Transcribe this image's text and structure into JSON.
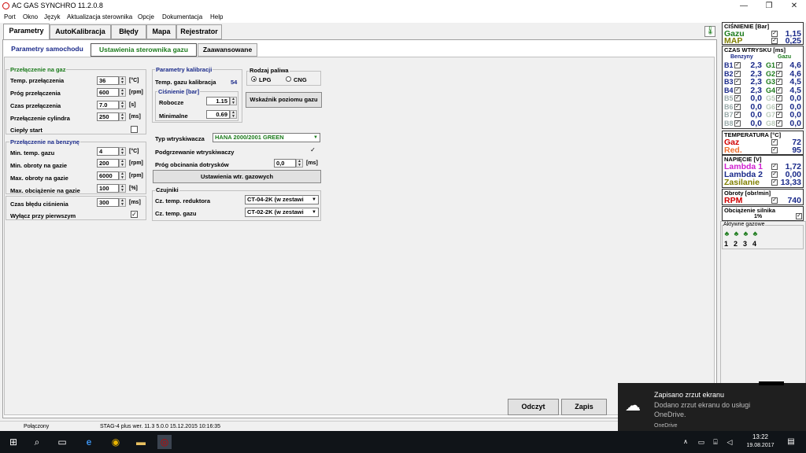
{
  "window": {
    "title": "AC GAS SYNCHRO  11.2.0.8",
    "minimize": "—",
    "maximize": "❐",
    "close": "✕"
  },
  "menu": [
    "Port",
    "Okno",
    "Język",
    "Aktualizacja sterownika",
    "Opcje",
    "Dokumentacja",
    "Help"
  ],
  "tabs": [
    "Parametry",
    "AutoKalibracja",
    "Błędy",
    "Mapa",
    "Rejestrator"
  ],
  "subtabs": [
    "Parametry samochodu",
    "Ustawienia sterownika gazu",
    "Zaawansowane"
  ],
  "przelaczenie_gaz": {
    "title": "Przełączenie na gaz",
    "rows": [
      {
        "label": "Temp. przełączenia",
        "value": "36",
        "unit": "[°C]"
      },
      {
        "label": "Próg przełączenia",
        "value": "600",
        "unit": "[rpm]"
      },
      {
        "label": "Czas przełączenia",
        "value": "7.0",
        "unit": "[s]"
      },
      {
        "label": "Przełączenie cylindra",
        "value": "250",
        "unit": "[ms]"
      }
    ],
    "cieply_start": "Ciepły start"
  },
  "przelaczenie_benzyna": {
    "title": "Przełączenie na benzynę",
    "rows": [
      {
        "label": "Min. temp. gazu",
        "value": "4",
        "unit": "[°C]"
      },
      {
        "label": "Min. obroty na gazie",
        "value": "200",
        "unit": "[rpm]"
      },
      {
        "label": "Max. obroty na gazie",
        "value": "6000",
        "unit": "[rpm]"
      },
      {
        "label": "Max. obciążenie na gazie",
        "value": "100",
        "unit": "[%]"
      }
    ]
  },
  "czas_bledu": {
    "label": "Czas błędu ciśnienia",
    "value": "300",
    "unit": "[ms]",
    "wylacz": "Wyłącz przy pierwszym",
    "wylacz_checked": "✓"
  },
  "kalibracja": {
    "title": "Parametry kalibracji",
    "temp_label": "Temp. gazu kalibracja",
    "temp_value": "54",
    "cisnienie_title": "Ciśnienie [bar]",
    "robocze_label": "Robocze",
    "robocze_value": "1.15",
    "minimalne_label": "Minimalne",
    "minimalne_value": "0.69"
  },
  "paliwo": {
    "title": "Rodzaj paliwa",
    "lpg": "LPG",
    "cng": "CNG",
    "wskaznik": "Wskaźnik poziomu gazu"
  },
  "wtryskiwacz": {
    "typ_label": "Typ wtryskiwacza",
    "typ_value": "HANA 2000/2001 GREEN",
    "podgrzewanie": "Podgrzewanie wtryskiwaczy",
    "podgrzewanie_checked": "✓",
    "prog_label": "Próg obcinania dotrysków",
    "prog_value": "0,0",
    "prog_unit": "[ms]",
    "ustawienia": "Ustawienia wtr. gazowych"
  },
  "czujniki": {
    "title": "Czujniki",
    "reduktor_label": "Cz. temp. reduktora",
    "reduktor_value": "CT-04-2K (w zestawi",
    "gaz_label": "Cz. temp. gazu",
    "gaz_value": "CT-02-2K (w zestawi"
  },
  "buttons": {
    "odczyt": "Odczyt",
    "zapis": "Zapis"
  },
  "right": {
    "cisnienie": {
      "title": "CIŚNIENIE [Bar]",
      "gazu_label": "Gazu",
      "gazu_value": "1,15",
      "map_label": "MAP",
      "map_value": "0,25"
    },
    "czas": {
      "title": "CZAS WTRYSKU  [ms]",
      "benzyny": "Benzyny",
      "gazu": "Gazu",
      "rows": [
        {
          "b": "B1",
          "bv": "2,3",
          "g": "G1",
          "gv": "4,6"
        },
        {
          "b": "B2",
          "bv": "2,3",
          "g": "G2",
          "gv": "4,6"
        },
        {
          "b": "B3",
          "bv": "2,3",
          "g": "G3",
          "gv": "4,5"
        },
        {
          "b": "B4",
          "bv": "2,3",
          "g": "G4",
          "gv": "4,5"
        },
        {
          "b": "B5",
          "bv": "0,0",
          "g": "G5",
          "gv": "0,0"
        },
        {
          "b": "B6",
          "bv": "0,0",
          "g": "G6",
          "gv": "0,0"
        },
        {
          "b": "B7",
          "bv": "0,0",
          "g": "G7",
          "gv": "0,0"
        },
        {
          "b": "B8",
          "bv": "0,0",
          "g": "G8",
          "gv": "0,0"
        }
      ]
    },
    "temperatura": {
      "title": "TEMPERATURA  [°C]",
      "gaz_label": "Gaz",
      "gaz_value": "72",
      "red_label": "Red.",
      "red_value": "95"
    },
    "napiecie": {
      "title": "NAPIĘCIE [V]",
      "l1_label": "Lambda 1",
      "l1_value": "1,72",
      "l2_label": "Lambda 2",
      "l2_value": "0,00",
      "zas_label": "Zasilanie",
      "zas_value": "13,33"
    },
    "obroty": {
      "title": "Obroty [obr/min]",
      "label": "RPM",
      "value": "740"
    },
    "obciazenie": {
      "title": "Obciążenie silnika",
      "value": "1%"
    },
    "aktywne": {
      "title": "Aktywne gazowe",
      "nums": [
        "1",
        "2",
        "3",
        "4"
      ]
    }
  },
  "status": {
    "polaczony": "Połączony",
    "device": "STAG-4 plus   wer.  11.3  5.0.0    15.12.2015 10:16:35"
  },
  "toast": {
    "title": "Zapisano zrzut ekranu",
    "line1": "Dodano zrzut ekranu do usługi",
    "line2": "OneDrive.",
    "source": "OneDrive"
  },
  "clock": {
    "time": "13:22",
    "date": "19.08.2017"
  },
  "colors": {
    "green": "#1a7a1a",
    "blue": "#1a2a8a",
    "red": "#d00000",
    "magenta": "#d020d0",
    "olive": "#808000"
  }
}
